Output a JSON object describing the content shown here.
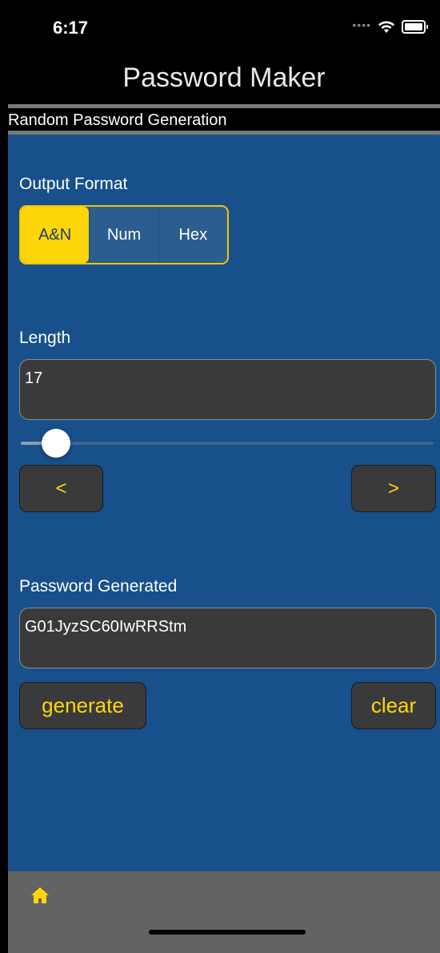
{
  "status": {
    "time": "6:17"
  },
  "nav": {
    "title": "Password Maker"
  },
  "section": {
    "header": "Random Password Generation"
  },
  "output_format": {
    "label": "Output Format",
    "options": [
      "A&N",
      "Num",
      "Hex"
    ],
    "selected": "A&N"
  },
  "length": {
    "label": "Length",
    "value": "17",
    "slider_fraction": 0.08,
    "decrement_label": "<",
    "increment_label": ">"
  },
  "password": {
    "label": "Password Generated",
    "value": "G01JyzSC60IwRRStm",
    "generate_label": "generate",
    "clear_label": "clear"
  },
  "colors": {
    "background": "#17508b",
    "accent": "#ffd60a",
    "field": "#3a3a3c",
    "tabbar": "#636366"
  },
  "tabbar": {
    "icon": "home-icon"
  }
}
